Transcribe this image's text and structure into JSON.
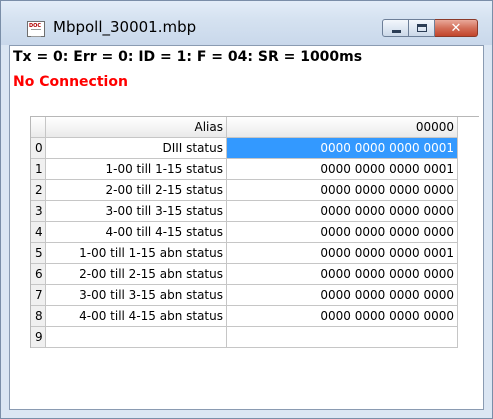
{
  "window": {
    "title": "Mbpoll_30001.mbp",
    "icon_text": "DOC",
    "close_glyph": "✕"
  },
  "status": {
    "line": "Tx = 0: Err = 0: ID = 1: F = 04: SR = 1000ms",
    "connection": "No Connection"
  },
  "table": {
    "headers": {
      "index": "",
      "alias": "Alias",
      "value": "00000"
    },
    "rows": [
      {
        "index": "0",
        "alias": "DIII status",
        "value": "0000 0000 0000 0001"
      },
      {
        "index": "1",
        "alias": "1-00 till 1-15 status",
        "value": "0000 0000 0000 0001"
      },
      {
        "index": "2",
        "alias": "2-00 till 2-15 status",
        "value": "0000 0000 0000 0000"
      },
      {
        "index": "3",
        "alias": "3-00 till 3-15 status",
        "value": "0000 0000 0000 0000"
      },
      {
        "index": "4",
        "alias": "4-00 till 4-15 status",
        "value": "0000 0000 0000 0000"
      },
      {
        "index": "5",
        "alias": "1-00 till 1-15 abn status",
        "value": "0000 0000 0000 0001"
      },
      {
        "index": "6",
        "alias": "2-00 till 2-15 abn status",
        "value": "0000 0000 0000 0000"
      },
      {
        "index": "7",
        "alias": "3-00 till 3-15 abn status",
        "value": "0000 0000 0000 0000"
      },
      {
        "index": "8",
        "alias": "4-00 till 4-15 abn status",
        "value": "0000 0000 0000 0000"
      },
      {
        "index": "9",
        "alias": "",
        "value": ""
      }
    ]
  },
  "colors": {
    "selection": "#3399ff",
    "error_text": "#ff0000"
  }
}
